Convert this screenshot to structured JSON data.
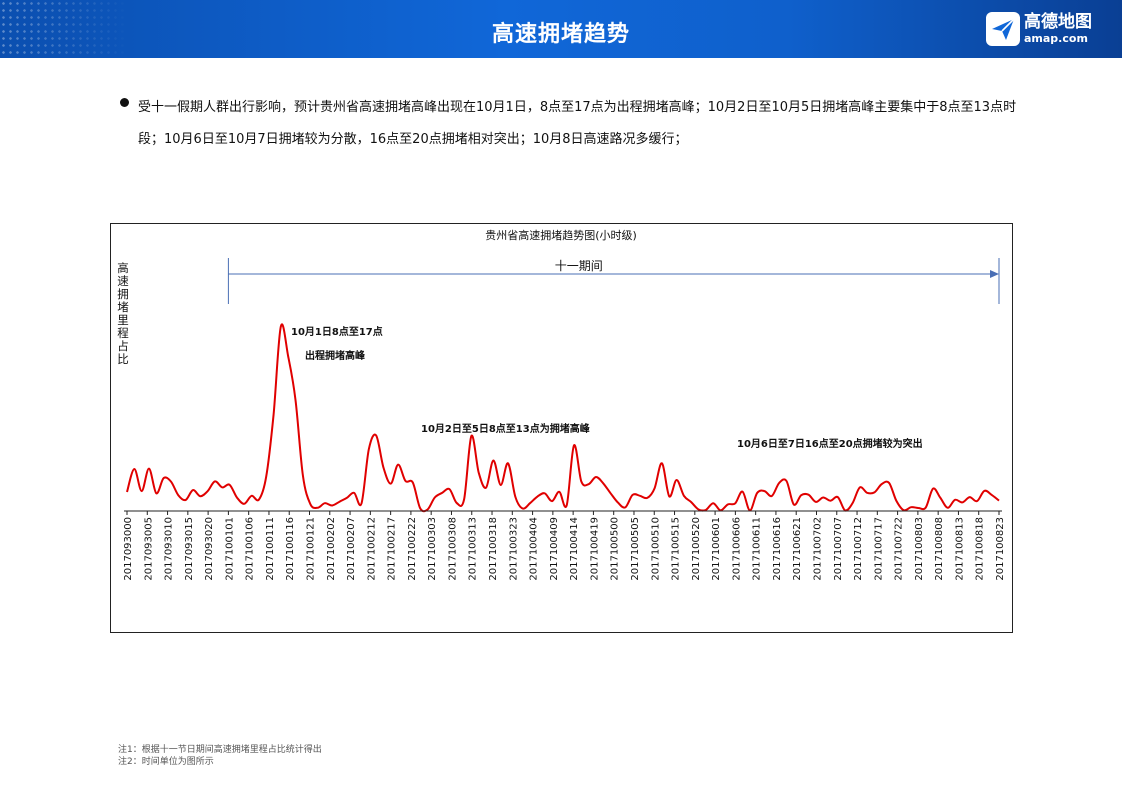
{
  "header": {
    "title": "高速拥堵趋势"
  },
  "logo": {
    "cn": "高德地图",
    "en": "amap.com"
  },
  "bullet": {
    "text": "受十一假期人群出行影响，预计贵州省高速拥堵高峰出现在10月1日，8点至17点为出程拥堵高峰；10月2日至10月5日拥堵高峰主要集中于8点至13点时段；10月6日至10月7日拥堵较为分散，16点至20点拥堵相对突出；10月8日高速路况多缓行；"
  },
  "colors": {
    "header": "#0f60cc",
    "line": "#e00000",
    "arrow": "#4a6fb5"
  },
  "chart_data": {
    "type": "line",
    "title": "贵州省高速拥堵趋势图(小时级)",
    "ylabel": "高速拥堵里程占比",
    "xlabel": "",
    "grid": false,
    "categories": [
      "2017093000",
      "2017093005",
      "2017093010",
      "2017093015",
      "2017093020",
      "2017100101",
      "2017100106",
      "2017100111",
      "2017100116",
      "2017100121",
      "2017100202",
      "2017100207",
      "2017100212",
      "2017100217",
      "2017100222",
      "2017100303",
      "2017100308",
      "2017100313",
      "2017100318",
      "2017100323",
      "2017100404",
      "2017100409",
      "2017100414",
      "2017100419",
      "2017100500",
      "2017100505",
      "2017100510",
      "2017100515",
      "2017100520",
      "2017100601",
      "2017100606",
      "2017100611",
      "2017100616",
      "2017100621",
      "2017100702",
      "2017100707",
      "2017100712",
      "2017100717",
      "2017100722",
      "2017100803",
      "2017100808",
      "2017100813",
      "2017100818",
      "2017100823"
    ],
    "values": [
      0.1,
      0.221,
      0.105,
      0.223,
      0.093,
      0.173,
      0.155,
      0.083,
      0.058,
      0.11,
      0.078,
      0.104,
      0.156,
      0.124,
      0.138,
      0.071,
      0.038,
      0.08,
      0.06,
      0.181,
      0.508,
      0.972,
      0.813,
      0.584,
      0.187,
      0.038,
      0.017,
      0.041,
      0.029,
      0.049,
      0.069,
      0.095,
      0.04,
      0.325,
      0.398,
      0.228,
      0.144,
      0.244,
      0.158,
      0.15,
      0.015,
      0.007,
      0.071,
      0.095,
      0.115,
      0.042,
      0.061,
      0.395,
      0.202,
      0.123,
      0.266,
      0.137,
      0.251,
      0.074,
      0.013,
      0.041,
      0.076,
      0.093,
      0.052,
      0.101,
      0.03,
      0.346,
      0.156,
      0.141,
      0.179,
      0.145,
      0.093,
      0.044,
      0.019,
      0.085,
      0.08,
      0.069,
      0.12,
      0.251,
      0.077,
      0.163,
      0.08,
      0.047,
      0.008,
      0.006,
      0.041,
      0.003,
      0.035,
      0.04,
      0.102,
      0.003,
      0.095,
      0.105,
      0.079,
      0.148,
      0.158,
      0.034,
      0.083,
      0.086,
      0.048,
      0.071,
      0.054,
      0.073,
      0.003,
      0.04,
      0.124,
      0.096,
      0.098,
      0.142,
      0.148,
      0.053,
      0.004,
      0.02,
      0.016,
      0.018,
      0.118,
      0.069,
      0.017,
      0.059,
      0.045,
      0.073,
      0.052,
      0.106,
      0.085,
      0.055
    ],
    "ylim": [
      0,
      1
    ],
    "annotations": [
      {
        "lines": [
          "10月1日8点至17点",
          "出程拥堵高峰"
        ]
      },
      {
        "lines": [
          "10月2日至5日8点至13点为拥堵高峰"
        ]
      },
      {
        "lines": [
          "10月6日至7日16点至20点拥堵较为突出"
        ]
      }
    ],
    "span": {
      "label": "十一期间",
      "from": "2017100101",
      "to": "2017100823"
    }
  },
  "notes": [
    "注1：根据十一节日期间高速拥堵里程占比统计得出",
    "注2：时间单位为图所示"
  ]
}
